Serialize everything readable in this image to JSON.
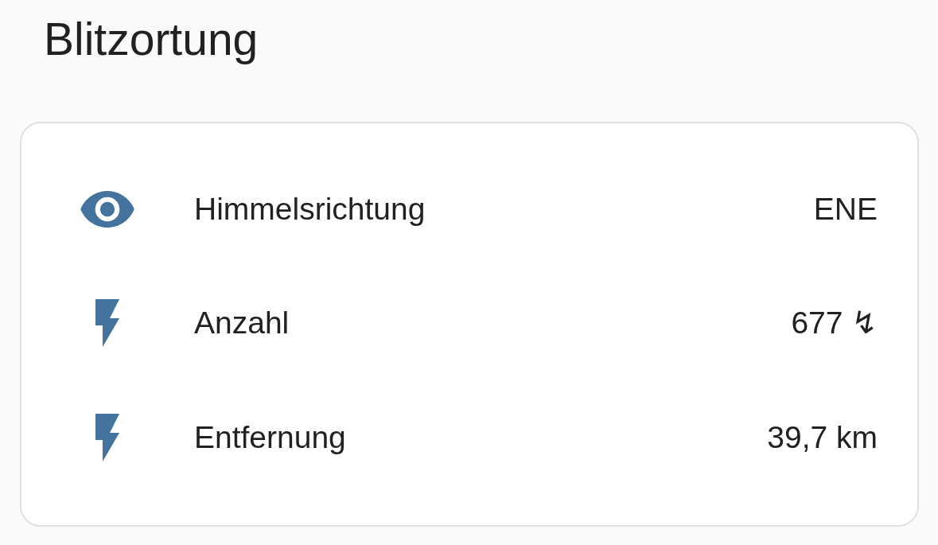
{
  "title": "Blitzortung",
  "entities": [
    {
      "kind": "direction",
      "name": "Himmelsrichtung",
      "state": "ENE"
    },
    {
      "kind": "count",
      "name": "Anzahl",
      "state": "677 ↯"
    },
    {
      "kind": "distance",
      "name": "Entfernung",
      "state": "39,7 km"
    }
  ]
}
